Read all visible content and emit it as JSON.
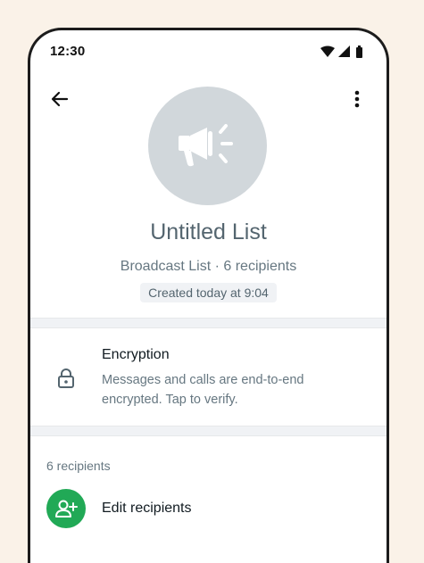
{
  "status_bar": {
    "time": "12:30",
    "icons": [
      "wifi-icon",
      "cell-signal-icon",
      "battery-icon"
    ]
  },
  "toolbar": {
    "back_icon": "arrow-left-icon",
    "menu_icon": "more-vertical-icon"
  },
  "profile": {
    "avatar_icon": "megaphone-icon",
    "title": "Untitled List",
    "subtitle": "Broadcast List · 6 recipients",
    "created": "Created today at 9:04"
  },
  "encryption": {
    "icon": "lock-icon",
    "title": "Encryption",
    "description": "Messages and calls are end-to-end encrypted. Tap to verify."
  },
  "recipients": {
    "header": "6 recipients",
    "edit_label": "Edit recipients",
    "edit_icon": "add-person-icon"
  },
  "colors": {
    "page_background": "#faf2e8",
    "avatar_background": "#d1d7db",
    "accent_green": "#21a956",
    "divider": "#f0f2f5"
  }
}
